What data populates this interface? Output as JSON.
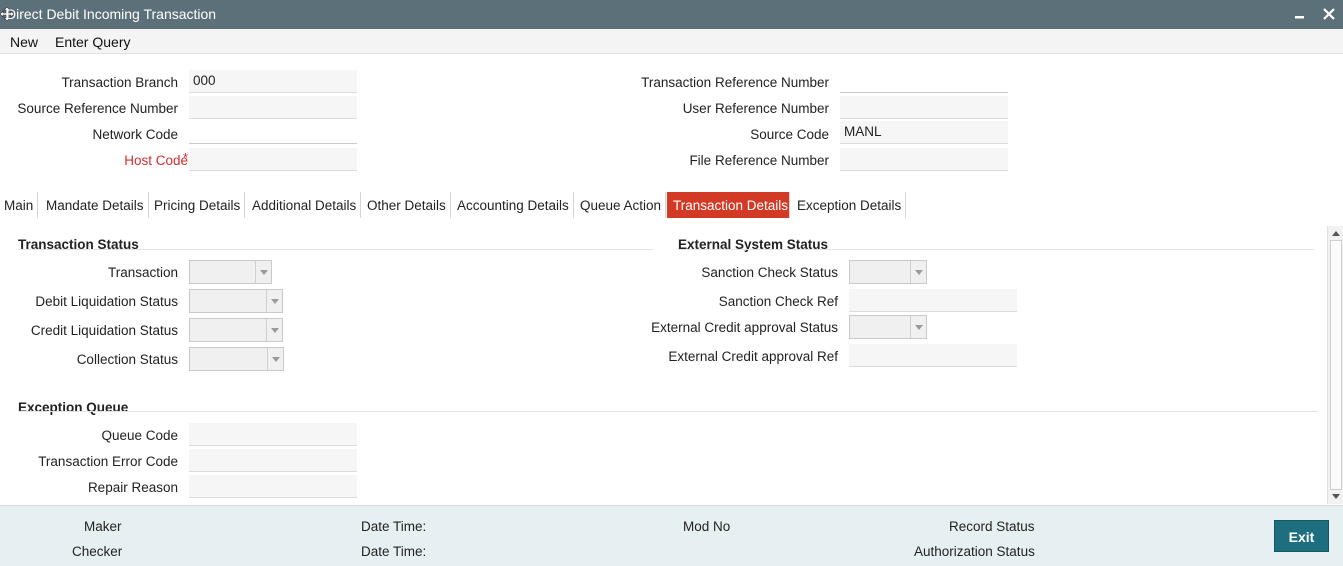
{
  "window": {
    "title": "Direct Debit Incoming Transaction",
    "minimize_icon": "minimize-icon",
    "close_icon": "close-icon"
  },
  "menu": {
    "new": "New",
    "enter_query": "Enter Query"
  },
  "header": {
    "transaction_branch_label": "Transaction Branch",
    "transaction_branch_value": "000",
    "source_reference_number_label": "Source Reference Number",
    "source_reference_number_value": "",
    "network_code_label": "Network Code",
    "network_code_value": "",
    "host_code_label": "Host Code",
    "host_code_required": "*",
    "host_code_value": "",
    "transaction_reference_number_label": "Transaction Reference Number",
    "transaction_reference_number_value": "",
    "user_reference_number_label": "User Reference Number",
    "user_reference_number_value": "",
    "source_code_label": "Source Code",
    "source_code_value": "MANL",
    "file_reference_number_label": "File Reference Number",
    "file_reference_number_value": ""
  },
  "tabs": [
    {
      "label": "Main"
    },
    {
      "label": "Mandate Details"
    },
    {
      "label": "Pricing Details"
    },
    {
      "label": "Additional Details"
    },
    {
      "label": "Other Details"
    },
    {
      "label": "Accounting Details"
    },
    {
      "label": "Queue Action"
    },
    {
      "label": "Transaction Details",
      "active": true
    },
    {
      "label": "Exception Details"
    }
  ],
  "transaction_status": {
    "heading": "Transaction Status",
    "transaction_label": "Transaction",
    "debit_liquidation_status_label": "Debit Liquidation Status",
    "credit_liquidation_status_label": "Credit Liquidation Status",
    "collection_status_label": "Collection Status"
  },
  "external_system_status": {
    "heading": "External System Status",
    "sanction_check_status_label": "Sanction Check Status",
    "sanction_check_ref_label": "Sanction Check Ref",
    "external_credit_approval_status_label": "External Credit approval Status",
    "external_credit_approval_ref_label": "External Credit approval Ref"
  },
  "exception_queue": {
    "heading": "Exception Queue",
    "queue_code_label": "Queue Code",
    "transaction_error_code_label": "Transaction Error Code",
    "repair_reason_label": "Repair Reason"
  },
  "footer": {
    "maker_label": "Maker",
    "checker_label": "Checker",
    "date_time_label_1": "Date Time:",
    "date_time_label_2": "Date Time:",
    "mod_no_label": "Mod No",
    "record_status_label": "Record Status",
    "authorization_status_label": "Authorization Status",
    "exit_label": "Exit"
  },
  "colors": {
    "titlebar": "#5b7078",
    "active_tab": "#d33a26",
    "exit_button": "#1d6e7e",
    "footer_bg": "#e6f0f2"
  }
}
